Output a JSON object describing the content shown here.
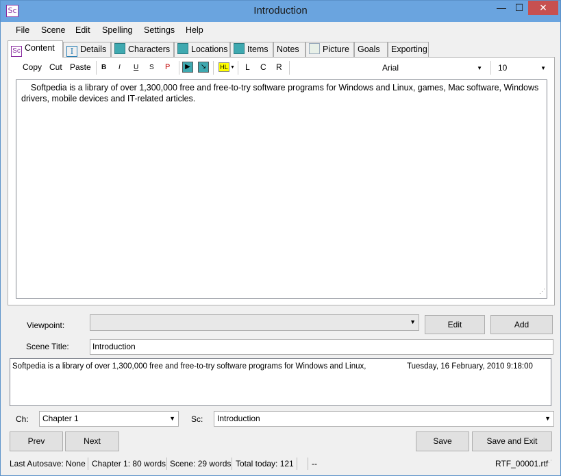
{
  "window": {
    "title": "Introduction",
    "app_icon_text": "Sc",
    "min_glyph": "—",
    "max_glyph": "☐",
    "close_glyph": "✕"
  },
  "menu": [
    "File",
    "Scene",
    "Edit",
    "Spelling",
    "Settings",
    "Help"
  ],
  "tabs": {
    "content": "Content",
    "details": "Details",
    "characters": "Characters",
    "locations": "Locations",
    "items": "Items",
    "notes": "Notes",
    "picture": "Picture",
    "goals": "Goals",
    "exporting": "Exporting",
    "content_icon_text": "Sc",
    "details_icon_text": "I"
  },
  "toolbar": {
    "copy": "Copy",
    "cut": "Cut",
    "paste": "Paste",
    "bold": "B",
    "italic": "I",
    "underline": "U",
    "strike": "S",
    "p": "P",
    "play_glyph": "▶",
    "tool_glyph": "↘",
    "highlight": "HL",
    "align_left": "L",
    "align_center": "C",
    "align_right": "R",
    "font": "Arial",
    "size": "10",
    "dropdown_glyph": "▼"
  },
  "editor": {
    "text": "    Softpedia is a library of over 1,300,000 free and free-to-try software programs for Windows and Linux, games, Mac software, Windows drivers, mobile devices and IT-related articles.",
    "grip_glyph": "⋰"
  },
  "viewpoint": {
    "label": "Viewpoint:",
    "value": "",
    "edit_button": "Edit",
    "add_button": "Add"
  },
  "scene_title": {
    "label": "Scene Title:",
    "value": "Introduction"
  },
  "summary": {
    "text": "Softpedia is a library of over 1,300,000 free and free-to-try software programs for Windows and Linux,",
    "date": "Tuesday, 16 February, 2010 9:18:00"
  },
  "chapter": {
    "label": "Ch:",
    "value": "Chapter 1"
  },
  "scene": {
    "label": "Sc:",
    "value": "Introduction"
  },
  "nav": {
    "prev": "Prev",
    "next": "Next",
    "save": "Save",
    "save_exit": "Save and Exit"
  },
  "status": {
    "autosave": "Last Autosave: None",
    "chapter_words": "Chapter 1: 80 words",
    "scene_words": "Scene: 29 words",
    "total_today": "Total today: 121",
    "dashes": "--",
    "file": "RTF_00001.rtf"
  },
  "colors": {
    "titlebar": "#6aa4df",
    "close": "#c75050",
    "accent": "#8a2da0",
    "teal_icon": "#3fa9b0",
    "highlight": "#ffff00"
  }
}
